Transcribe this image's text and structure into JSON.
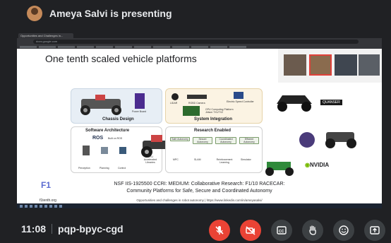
{
  "presenter": {
    "name": "Ameya Salvi is presenting"
  },
  "browser": {
    "tab_title": "Opportunities and Challenges in...",
    "url": "docs.google.com"
  },
  "slide": {
    "title": "One tenth scaled vehicle platforms",
    "chassis_label": "Chassis Design",
    "system_label": "System Integration",
    "software_label": "Software Architecture",
    "research_label": "Research Enabled",
    "power_board": "Power Board",
    "lidar": "LIDAR",
    "rgbd_camera": "RGBD Camera",
    "speed_controller": "Electric Speed Controller",
    "gpu_platform": "GPU Computing Platform Jetson TX1/TX2",
    "ros_label": "ROS",
    "ros_sub": "Built on ROS",
    "perception": "Perception",
    "planning": "Planning",
    "control": "Control",
    "gpu_accel": "GPU Accelerated Libraries",
    "research_items": [
      "Safe Autonomy",
      "Secure Autonomy",
      "Coordinated Autonomy",
      "Efficient Autonomy",
      "MPC",
      "SLAM",
      "Reinforcement Learning",
      "Simulator"
    ],
    "quanser": "QUANSER",
    "nvidia": "NVIDIA",
    "nsf_line1": "NSF IIS-1925500 CCRI: MEDIUM: Collaborative Research: F1/10 RACECAR:",
    "nsf_line2": "Community Platforms for Safe, Secure and Coordinated Autonomy",
    "credit": "Opportunities and challenges in robot autonomy | https://www.linkedin.com/in/ameyasalvi/",
    "f1_logo": "F1",
    "f1_url": "f1tenth.org"
  },
  "meeting": {
    "time": "11:08",
    "code": "pqp-bpyc-cgd"
  },
  "colors": {
    "accent_red": "#ea4335",
    "control_gray": "#3c4043",
    "background": "#202124"
  },
  "icons": {
    "mic": "mic-off-icon",
    "camera": "camera-off-icon",
    "captions": "captions-icon",
    "hand": "raise-hand-icon",
    "emoji": "emoji-icon",
    "present": "present-icon"
  }
}
